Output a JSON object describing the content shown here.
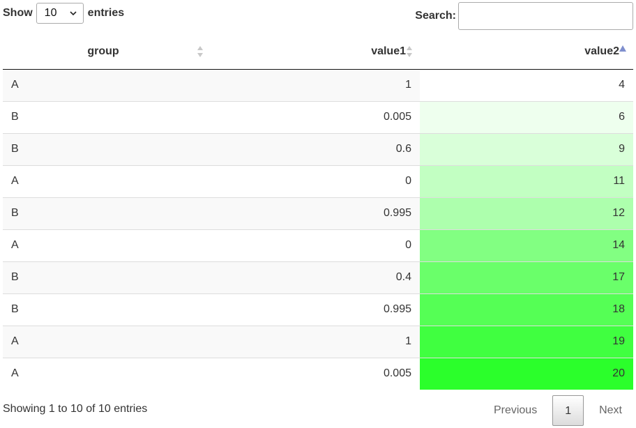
{
  "length_menu": {
    "prefix": "Show",
    "selected": "10",
    "suffix": "entries"
  },
  "search": {
    "label": "Search:",
    "value": ""
  },
  "table": {
    "columns": [
      "group",
      "value1",
      "value2"
    ],
    "sorted_column": "value2",
    "sort_direction": "ascending",
    "rows": [
      {
        "group": "A",
        "value1": "1",
        "value2": "4",
        "value2_bg": "#ffffff"
      },
      {
        "group": "B",
        "value1": "0.005",
        "value2": "6",
        "value2_bg": "#eeffee"
      },
      {
        "group": "B",
        "value1": "0.6",
        "value2": "9",
        "value2_bg": "#d9ffd9"
      },
      {
        "group": "A",
        "value1": "0",
        "value2": "11",
        "value2_bg": "#c2ffc2"
      },
      {
        "group": "B",
        "value1": "0.995",
        "value2": "12",
        "value2_bg": "#adffad"
      },
      {
        "group": "A",
        "value1": "0",
        "value2": "14",
        "value2_bg": "#82ff82"
      },
      {
        "group": "B",
        "value1": "0.4",
        "value2": "17",
        "value2_bg": "#6aff6a"
      },
      {
        "group": "B",
        "value1": "0.995",
        "value2": "18",
        "value2_bg": "#55ff55"
      },
      {
        "group": "A",
        "value1": "1",
        "value2": "19",
        "value2_bg": "#40ff40"
      },
      {
        "group": "A",
        "value1": "0.005",
        "value2": "20",
        "value2_bg": "#2bff2b"
      }
    ]
  },
  "info": "Showing 1 to 10 of 10 entries",
  "pagination": {
    "previous": "Previous",
    "current": "1",
    "next": "Next"
  },
  "colors": {
    "sort_active": "#7f8fce",
    "sort_inactive": "#c8c8c8"
  }
}
